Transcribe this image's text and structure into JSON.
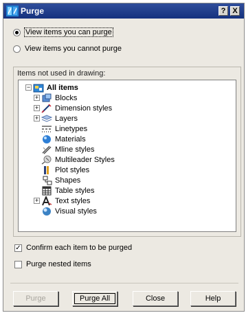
{
  "window": {
    "title": "Purge",
    "help_button": "?",
    "close_button": "X"
  },
  "view_options": {
    "purgeable_label": "View items you can purge",
    "non_purgeable_label": "View items you cannot purge",
    "selected": "purgeable"
  },
  "tree": {
    "group_label": "Items not used in drawing:",
    "root": {
      "label": "All items",
      "expander": "−",
      "icon": "all-items-icon"
    },
    "items": [
      {
        "label": "Blocks",
        "expandable": true,
        "icon": "blocks-icon"
      },
      {
        "label": "Dimension styles",
        "expandable": true,
        "icon": "dimension-styles-icon"
      },
      {
        "label": "Layers",
        "expandable": true,
        "icon": "layers-icon"
      },
      {
        "label": "Linetypes",
        "expandable": false,
        "icon": "linetypes-icon"
      },
      {
        "label": "Materials",
        "expandable": false,
        "icon": "materials-icon"
      },
      {
        "label": "Mline styles",
        "expandable": false,
        "icon": "mline-styles-icon"
      },
      {
        "label": "Multileader Styles",
        "expandable": false,
        "icon": "multileader-styles-icon"
      },
      {
        "label": "Plot styles",
        "expandable": false,
        "icon": "plot-styles-icon"
      },
      {
        "label": "Shapes",
        "expandable": false,
        "icon": "shapes-icon"
      },
      {
        "label": "Table styles",
        "expandable": false,
        "icon": "table-styles-icon"
      },
      {
        "label": "Text styles",
        "expandable": true,
        "icon": "text-styles-icon"
      },
      {
        "label": "Visual styles",
        "expandable": false,
        "icon": "visual-styles-icon"
      }
    ],
    "expander_symbol": "+"
  },
  "options": {
    "confirm_label": "Confirm each item to be purged",
    "confirm_checked": true,
    "confirm_mark": "✓",
    "nested_label": "Purge nested items",
    "nested_checked": false
  },
  "buttons": {
    "purge": "Purge",
    "purge_all": "Purge All",
    "close": "Close",
    "help": "Help"
  },
  "colors": {
    "titlebar": "#15317e",
    "dialog_bg": "#ece9e2",
    "disabled_text": "#a8a59e"
  }
}
